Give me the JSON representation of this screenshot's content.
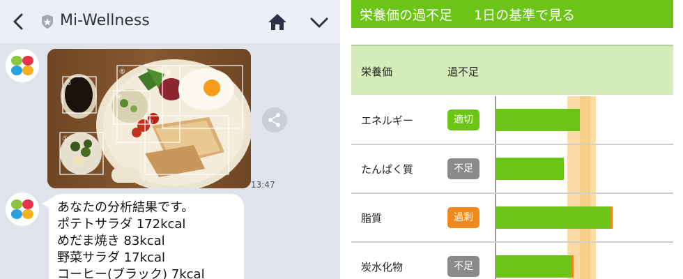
{
  "chat": {
    "title": "Mi-Wellness",
    "time": "13:47",
    "message_lines": [
      "あなたの分析結果です。",
      "ポテトサラダ 172kcal",
      "めだま焼き 83kcal",
      "野菜サラダ 17kcal",
      "コーヒー(ブラック) 7kcal"
    ],
    "photo_box_labels": [
      "①",
      "②",
      "③",
      "④",
      "⑤",
      "⑥"
    ]
  },
  "nutrition": {
    "title": "栄養価の過不足",
    "subtitle": "1日の基準で見る",
    "col_nutrient": "栄養価",
    "col_status": "過不足",
    "rows": [
      {
        "name": "エネルギー",
        "status": "適切",
        "status_color": "#6cc417",
        "value": 0.47
      },
      {
        "name": "たんぱく質",
        "status": "不足",
        "status_color": "#8a8a8a",
        "value": 0.38
      },
      {
        "name": "脂質",
        "status": "過剰",
        "status_color": "#f08a1c",
        "value": 0.64
      },
      {
        "name": "炭水化物",
        "status": "不足",
        "status_color": "#8a8a8a",
        "value": 0.42
      }
    ]
  },
  "colors": {
    "accent_green": "#6cc417",
    "header_bg": "#eceff5",
    "chat_bg": "#dfe3ec",
    "range_band": "#fcdba6",
    "excess_orange": "#f08a1c"
  },
  "icons": [
    "back-chevron-icon",
    "shield-icon",
    "home-icon",
    "chevron-down-icon",
    "share-icon",
    "clover-logo-icon"
  ]
}
